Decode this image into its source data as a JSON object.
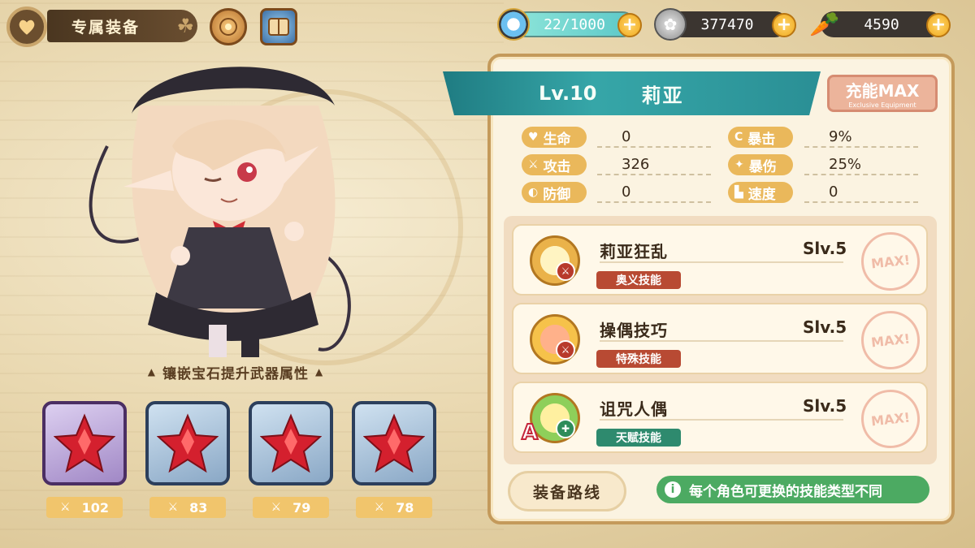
{
  "header": {
    "title": "专属装备",
    "stamina": "22/1000",
    "silver": "377470",
    "carrot": "4590"
  },
  "character": {
    "level": "Lv.10",
    "name": "莉亚",
    "max_label": "充能MAX",
    "max_sub": "Exclusive Equipment"
  },
  "stats": [
    {
      "label": "生命",
      "value": "0",
      "icon": "heart-icon"
    },
    {
      "label": "暴击",
      "value": "9%",
      "icon": "crit-icon"
    },
    {
      "label": "攻击",
      "value": "326",
      "icon": "sword-icon"
    },
    {
      "label": "暴伤",
      "value": "25%",
      "icon": "critdmg-icon"
    },
    {
      "label": "防御",
      "value": "0",
      "icon": "shield-icon"
    },
    {
      "label": "速度",
      "value": "0",
      "icon": "boot-icon"
    }
  ],
  "hint": "镶嵌宝石提升武器属性",
  "gems": [
    {
      "value": "102"
    },
    {
      "value": "83"
    },
    {
      "value": "79"
    },
    {
      "value": "78"
    }
  ],
  "skills": [
    {
      "name": "莉亚狂乱",
      "level": "Slv.5",
      "type": "奥义技能",
      "stamp": "MAX!"
    },
    {
      "name": "操偶技巧",
      "level": "Slv.5",
      "type": "特殊技能",
      "stamp": "MAX!"
    },
    {
      "name": "诅咒人偶",
      "level": "Slv.5",
      "type": "天赋技能",
      "stamp": "MAX!",
      "badge": "A"
    }
  ],
  "footer": {
    "route_label": "装备路线",
    "info_text": "每个角色可更换的技能类型不同"
  }
}
